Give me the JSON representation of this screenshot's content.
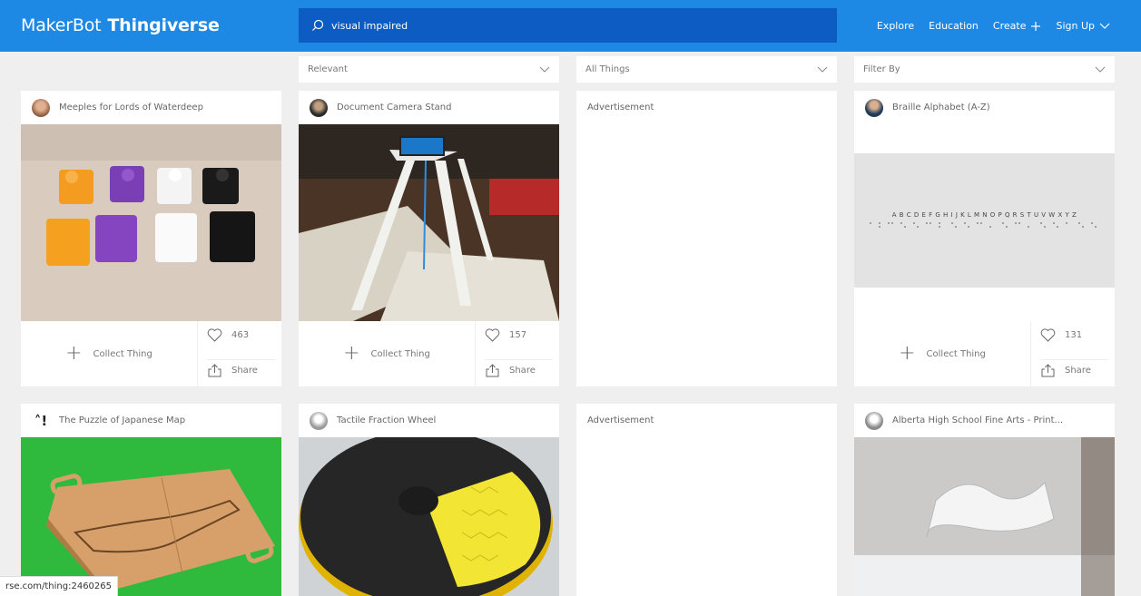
{
  "header": {
    "logo_maker": "MakerBot",
    "logo_thing": "Thingiverse",
    "search_value": "visual impaired",
    "nav": [
      {
        "label": "Explore",
        "icon": ""
      },
      {
        "label": "Education",
        "icon": ""
      },
      {
        "label": "Create",
        "icon": "plus-icon"
      },
      {
        "label": "Sign Up",
        "icon": "chevron-down-icon"
      }
    ]
  },
  "filters": {
    "sort": "Relevant",
    "type": "All Things",
    "filter_by": "Filter By"
  },
  "cards": [
    {
      "title": "Meeples for Lords of Waterdeep",
      "likes": "463",
      "collect": "Collect Thing",
      "share": "Share"
    },
    {
      "title": "Document Camera Stand",
      "likes": "157",
      "collect": "Collect Thing",
      "share": "Share"
    },
    {
      "title": "Braille Alphabet (A-Z)",
      "likes": "131",
      "collect": "Collect Thing",
      "share": "Share",
      "image_text": "A B C D E F G H I J K L M N O P Q R S T U V W X Y Z"
    },
    {
      "title": "The Puzzle of Japanese Map"
    },
    {
      "title": "Tactile Fraction Wheel"
    },
    {
      "title": "Alberta High School Fine Arts - Print..."
    }
  ],
  "ads": [
    "Advertisement",
    "Advertisement"
  ],
  "status_url": "rse.com/thing:2460265",
  "colors": {
    "header": "#1e88e5",
    "search": "#0d5cc4"
  }
}
